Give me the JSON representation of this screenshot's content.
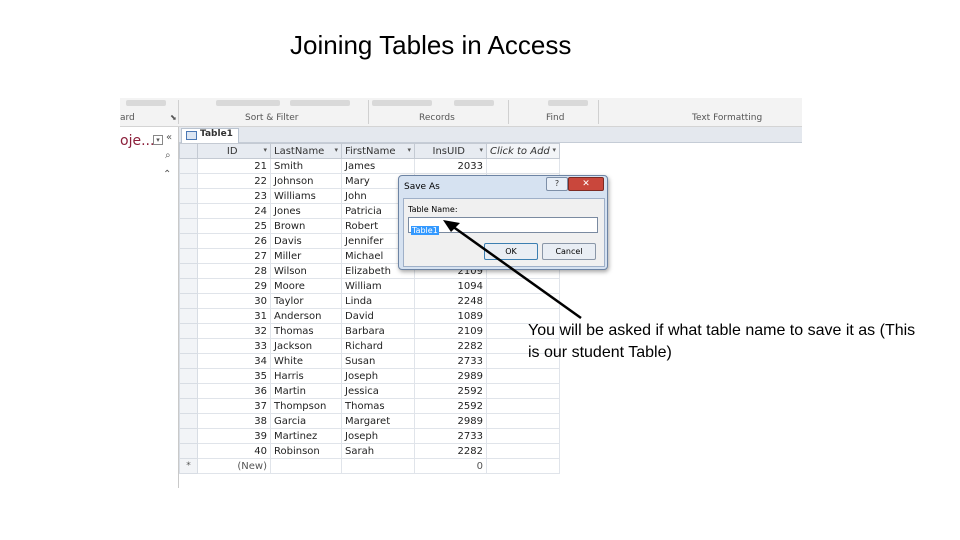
{
  "slide": {
    "title": "Joining Tables in Access",
    "callout": "You will be asked if what table name to save it as (This is our student Table)"
  },
  "ribbon": {
    "groups": [
      "ard",
      "Sort & Filter",
      "Records",
      "Find",
      "Text Formatting"
    ]
  },
  "nav": {
    "label": "oje..."
  },
  "tab": {
    "label": "Table1"
  },
  "table": {
    "columns": [
      "ID",
      "LastName",
      "FirstName",
      "InsUID",
      "Click to Add"
    ],
    "rows": [
      {
        "id": "21",
        "last": "Smith",
        "first": "James",
        "ins": "2033"
      },
      {
        "id": "22",
        "last": "Johnson",
        "first": "Mary",
        "ins": ""
      },
      {
        "id": "23",
        "last": "Williams",
        "first": "John",
        "ins": ""
      },
      {
        "id": "24",
        "last": "Jones",
        "first": "Patricia",
        "ins": ""
      },
      {
        "id": "25",
        "last": "Brown",
        "first": "Robert",
        "ins": ""
      },
      {
        "id": "26",
        "last": "Davis",
        "first": "Jennifer",
        "ins": ""
      },
      {
        "id": "27",
        "last": "Miller",
        "first": "Michael",
        "ins": ""
      },
      {
        "id": "28",
        "last": "Wilson",
        "first": "Elizabeth",
        "ins": "2109"
      },
      {
        "id": "29",
        "last": "Moore",
        "first": "William",
        "ins": "1094"
      },
      {
        "id": "30",
        "last": "Taylor",
        "first": "Linda",
        "ins": "2248"
      },
      {
        "id": "31",
        "last": "Anderson",
        "first": "David",
        "ins": "1089"
      },
      {
        "id": "32",
        "last": "Thomas",
        "first": "Barbara",
        "ins": "2109"
      },
      {
        "id": "33",
        "last": "Jackson",
        "first": "Richard",
        "ins": "2282"
      },
      {
        "id": "34",
        "last": "White",
        "first": "Susan",
        "ins": "2733"
      },
      {
        "id": "35",
        "last": "Harris",
        "first": "Joseph",
        "ins": "2989"
      },
      {
        "id": "36",
        "last": "Martin",
        "first": "Jessica",
        "ins": "2592"
      },
      {
        "id": "37",
        "last": "Thompson",
        "first": "Thomas",
        "ins": "2592"
      },
      {
        "id": "38",
        "last": "Garcia",
        "first": "Margaret",
        "ins": "2989"
      },
      {
        "id": "39",
        "last": "Martinez",
        "first": "Joseph",
        "ins": "2733"
      },
      {
        "id": "40",
        "last": "Robinson",
        "first": "Sarah",
        "ins": "2282"
      }
    ],
    "new_row": {
      "marker": "*",
      "id": "(New)",
      "ins": "0"
    }
  },
  "dialog": {
    "title": "Save As",
    "help_icon": "?",
    "close_icon": "✕",
    "field_label": "Table Name:",
    "field_value": "Table1",
    "ok_label": "OK",
    "cancel_label": "Cancel"
  }
}
